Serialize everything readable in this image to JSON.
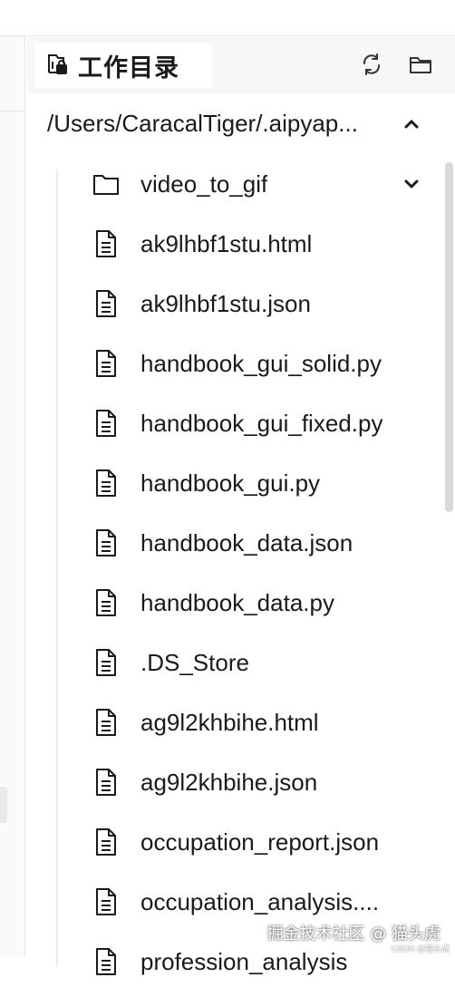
{
  "panel": {
    "title": "工作目录",
    "title_icon": "workspace-folder-icon",
    "refresh_icon": "refresh-icon",
    "open_folder_icon": "folder-icon"
  },
  "path": {
    "text": "/Users/CaracalTiger/.aipyap...",
    "toggle_icon": "chevron-up-icon"
  },
  "items": [
    {
      "name": "video_to_gif",
      "type": "folder",
      "icon": "folder-icon",
      "toggle_icon": "chevron-down-icon"
    },
    {
      "name": "ak9lhbf1stu.html",
      "type": "file",
      "icon": "file-icon"
    },
    {
      "name": "ak9lhbf1stu.json",
      "type": "file",
      "icon": "file-icon"
    },
    {
      "name": "handbook_gui_solid.py",
      "type": "file",
      "icon": "file-icon"
    },
    {
      "name": "handbook_gui_fixed.py",
      "type": "file",
      "icon": "file-icon"
    },
    {
      "name": "handbook_gui.py",
      "type": "file",
      "icon": "file-icon"
    },
    {
      "name": "handbook_data.json",
      "type": "file",
      "icon": "file-icon"
    },
    {
      "name": "handbook_data.py",
      "type": "file",
      "icon": "file-icon"
    },
    {
      "name": ".DS_Store",
      "type": "file",
      "icon": "file-icon"
    },
    {
      "name": "ag9l2khbihe.html",
      "type": "file",
      "icon": "file-icon"
    },
    {
      "name": "ag9l2khbihe.json",
      "type": "file",
      "icon": "file-icon"
    },
    {
      "name": "occupation_report.json",
      "type": "file",
      "icon": "file-icon"
    },
    {
      "name": "occupation_analysis....",
      "type": "file",
      "icon": "file-icon"
    },
    {
      "name": "profession_analysis",
      "type": "file",
      "icon": "file-icon"
    }
  ],
  "watermark": {
    "text": "掘金技术社区 @ 猫头虎",
    "sub": "CSDN @猫头虎"
  },
  "colors": {
    "header_bg": "#f7f7f8",
    "text": "#1a1a1a",
    "scrollbar": "#d9d9d9"
  }
}
